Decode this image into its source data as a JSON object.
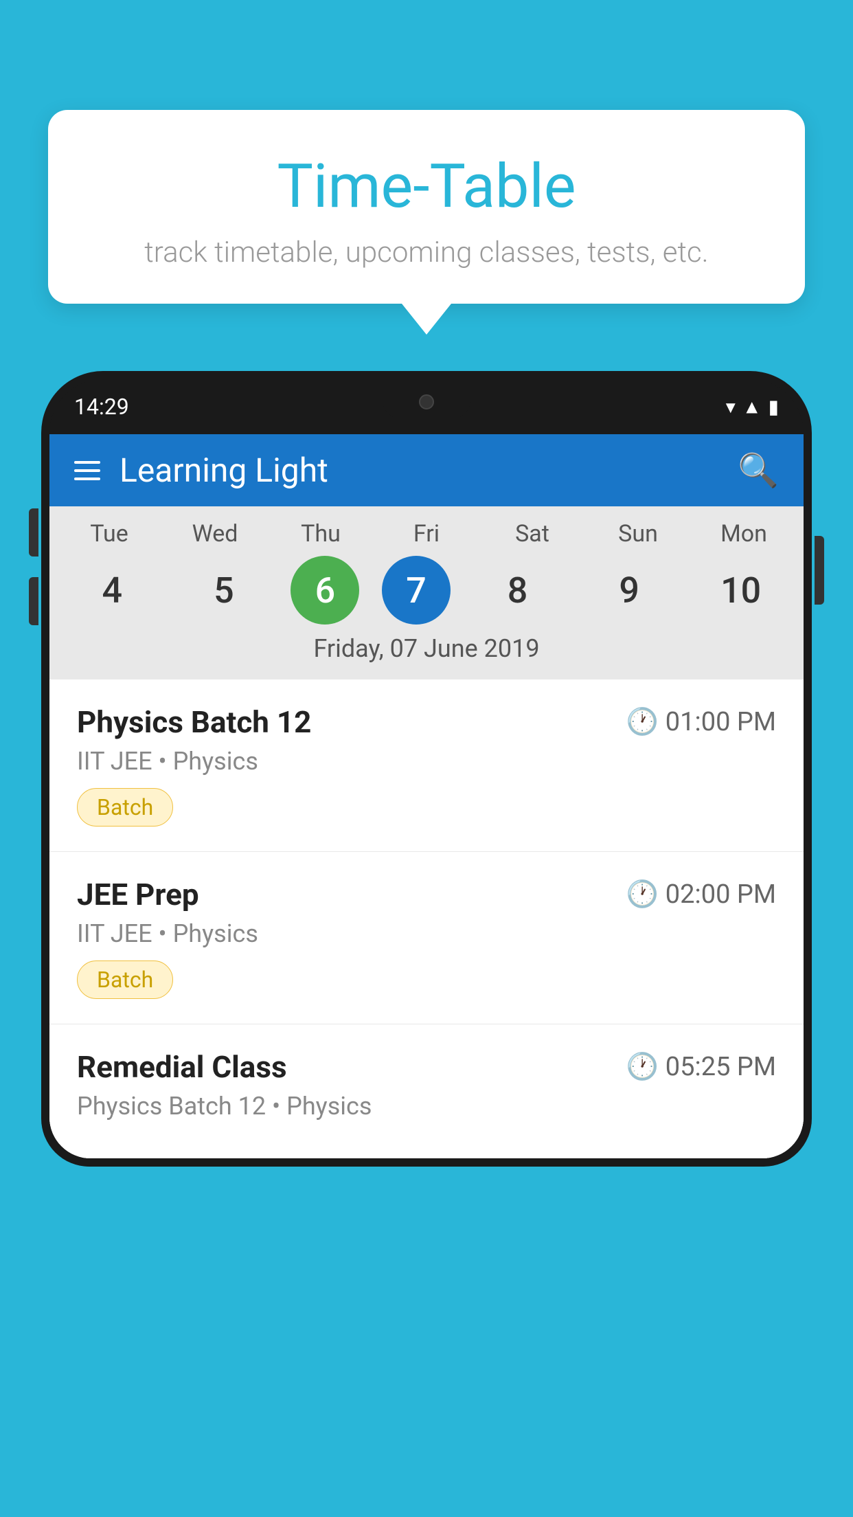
{
  "background_color": "#29B6D8",
  "tooltip": {
    "title": "Time-Table",
    "subtitle": "track timetable, upcoming classes, tests, etc."
  },
  "phone": {
    "status_bar": {
      "time": "14:29"
    },
    "app_header": {
      "title": "Learning Light"
    },
    "calendar": {
      "days": [
        {
          "name": "Tue",
          "num": "4"
        },
        {
          "name": "Wed",
          "num": "5"
        },
        {
          "name": "Thu",
          "num": "6",
          "state": "today"
        },
        {
          "name": "Fri",
          "num": "7",
          "state": "selected"
        },
        {
          "name": "Sat",
          "num": "8"
        },
        {
          "name": "Sun",
          "num": "9"
        },
        {
          "name": "Mon",
          "num": "10"
        }
      ],
      "selected_date_label": "Friday, 07 June 2019"
    },
    "schedule": [
      {
        "title": "Physics Batch 12",
        "time": "01:00 PM",
        "subtitle": "IIT JEE • Physics",
        "badge": "Batch"
      },
      {
        "title": "JEE Prep",
        "time": "02:00 PM",
        "subtitle": "IIT JEE • Physics",
        "badge": "Batch"
      },
      {
        "title": "Remedial Class",
        "time": "05:25 PM",
        "subtitle": "Physics Batch 12 • Physics",
        "badge": null
      }
    ]
  }
}
